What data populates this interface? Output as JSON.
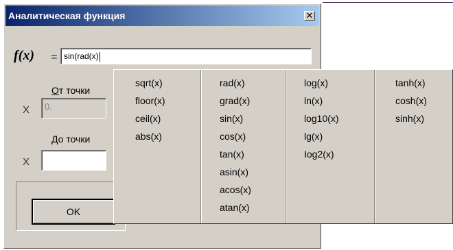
{
  "dialog": {
    "title": "Аналитическая функция",
    "close_icon": "close-icon"
  },
  "function": {
    "label": "f(x)",
    "equals": "=",
    "value": "sin(rad(x)"
  },
  "from": {
    "label_hotkey": "О",
    "label_rest": "т точки",
    "x_label": "X",
    "value": "0."
  },
  "to": {
    "label_hotkey": "Д",
    "label_rest": "о точки",
    "x_label": "X",
    "value": ""
  },
  "buttons": {
    "ok": "OK"
  },
  "popup": {
    "columns": [
      [
        "sqrt(x)",
        "floor(x)",
        "ceil(x)",
        "abs(x)"
      ],
      [
        "rad(x)",
        "grad(x)",
        "sin(x)",
        "cos(x)",
        "tan(x)",
        "asin(x)",
        "acos(x)",
        "atan(x)"
      ],
      [
        "log(x)",
        "ln(x)",
        "log10(x)",
        "lg(x)",
        "Iog2(x)"
      ],
      [
        "tanh(x)",
        "cosh(x)",
        "sinh(x)"
      ]
    ]
  }
}
